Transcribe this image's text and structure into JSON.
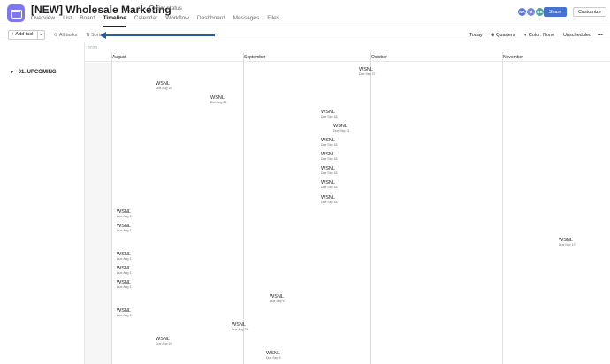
{
  "header": {
    "title": "[NEW] Wholesale Marketing",
    "set_status": "Set status",
    "tabs": [
      "Overview",
      "List",
      "Board",
      "Timeline",
      "Calendar",
      "Workflow",
      "Dashboard",
      "Messages",
      "Files"
    ],
    "active_tab": "Timeline",
    "avatars": [
      {
        "initials": "NA",
        "color": "#5a7bd6"
      },
      {
        "initials": "M",
        "color": "#7a8ad6"
      },
      {
        "initials": "BB",
        "color": "#4ea3a3"
      }
    ],
    "share_label": "Share",
    "customize_label": "Customize"
  },
  "toolbar": {
    "add_task": "+ Add task",
    "all_tasks": "All tasks",
    "sort": "Sort",
    "today": "Today",
    "quarters": "Quarters",
    "color": "Color: None",
    "unscheduled": "Unscheduled",
    "more": "•••"
  },
  "sidebar": {
    "section": "01. UPCOMING"
  },
  "timeline": {
    "year": "2023",
    "months": [
      "August",
      "September",
      "October",
      "November"
    ],
    "tasks": [
      {
        "name": "WSNL",
        "due": "Due Sep 27"
      },
      {
        "name": "WSNL",
        "due": "Due Aug 10"
      },
      {
        "name": "WSNL",
        "due": "Due Aug 23"
      },
      {
        "name": "WSNL",
        "due": "Due Sep 18"
      },
      {
        "name": "WSNL",
        "due": "Due Sep 21"
      },
      {
        "name": "WSNL",
        "due": "Due Sep 18"
      },
      {
        "name": "WSNL",
        "due": "Due Sep 18"
      },
      {
        "name": "WSNL",
        "due": "Due Sep 18"
      },
      {
        "name": "WSNL",
        "due": "Due Sep 18"
      },
      {
        "name": "WSNL",
        "due": "Due Sep 18"
      },
      {
        "name": "WSNL",
        "due": "Due Aug 1"
      },
      {
        "name": "WSNL",
        "due": "Due Aug 1"
      },
      {
        "name": "WSNL",
        "due": "Due Nov 13"
      },
      {
        "name": "WSNL",
        "due": "Due Aug 1"
      },
      {
        "name": "WSNL",
        "due": "Due Aug 1"
      },
      {
        "name": "WSNL",
        "due": "Due Aug 1"
      },
      {
        "name": "WSNL",
        "due": "Due Sep 6"
      },
      {
        "name": "WSNL",
        "due": "Due Aug 1"
      },
      {
        "name": "WSNL",
        "due": "Due Aug 28"
      },
      {
        "name": "WSNL",
        "due": "Due Aug 10"
      },
      {
        "name": "WSNL",
        "due": "Due Sep 5"
      }
    ]
  }
}
